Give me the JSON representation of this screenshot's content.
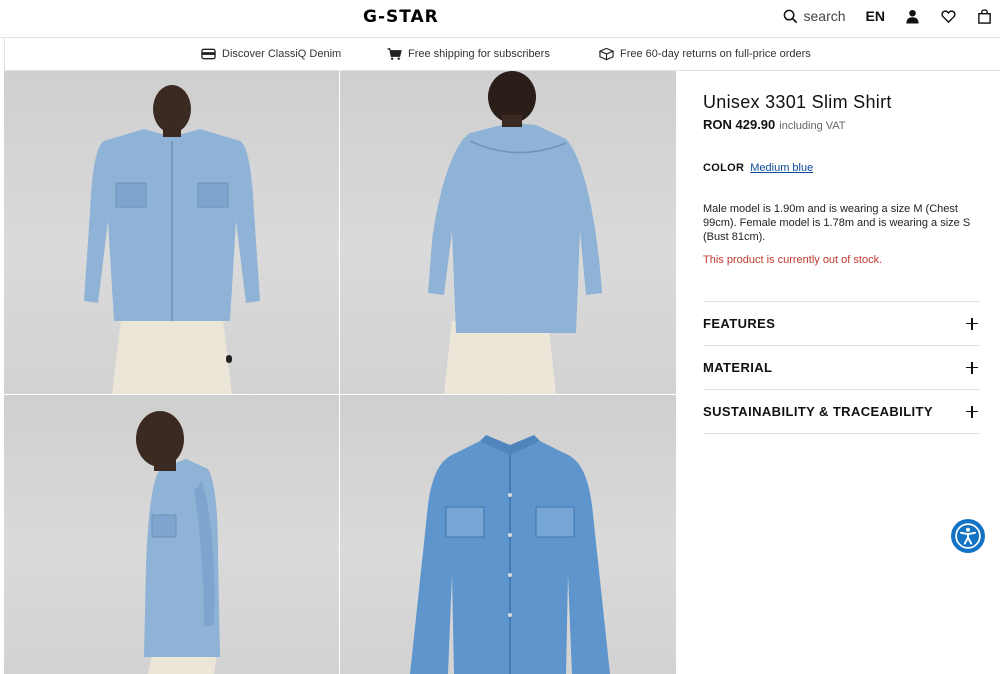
{
  "header": {
    "logo": "G-STAR",
    "search_placeholder": "search",
    "language": "EN",
    "icons": [
      "search-icon",
      "account-icon",
      "wishlist-heart-icon",
      "shopping-bag-icon"
    ]
  },
  "usp_bar": {
    "items": [
      {
        "icon": "denim-card-icon",
        "label": "Discover ClassiQ Denim"
      },
      {
        "icon": "shopping-cart-icon",
        "label": "Free shipping for subscribers"
      },
      {
        "icon": "return-box-icon",
        "label": "Free 60-day returns on full-price orders"
      }
    ]
  },
  "gallery": {
    "images": [
      {
        "name": "model-front-view"
      },
      {
        "name": "model-back-view"
      },
      {
        "name": "model-side-view"
      },
      {
        "name": "shirt-flat-front"
      }
    ]
  },
  "product": {
    "title": "Unisex 3301 Slim Shirt",
    "price": "RON 429.90",
    "vat_note": "including VAT",
    "color_label": "COLOR",
    "color_value": "Medium blue",
    "model_info": "Male model is 1.90m and is wearing a size M (Chest 99cm). Female model is 1.78m and is wearing a size S (Bust 81cm).",
    "stock_message": "This product is currently out of stock."
  },
  "accordion": [
    {
      "label": "FEATURES"
    },
    {
      "label": "MATERIAL"
    },
    {
      "label": "SUSTAINABILITY & TRACEABILITY"
    }
  ],
  "colors": {
    "accent_link": "#0b4b9a",
    "out_of_stock": "#c0392b",
    "accessibility_button": "#1273c4",
    "denim": "#8fb3d6"
  }
}
